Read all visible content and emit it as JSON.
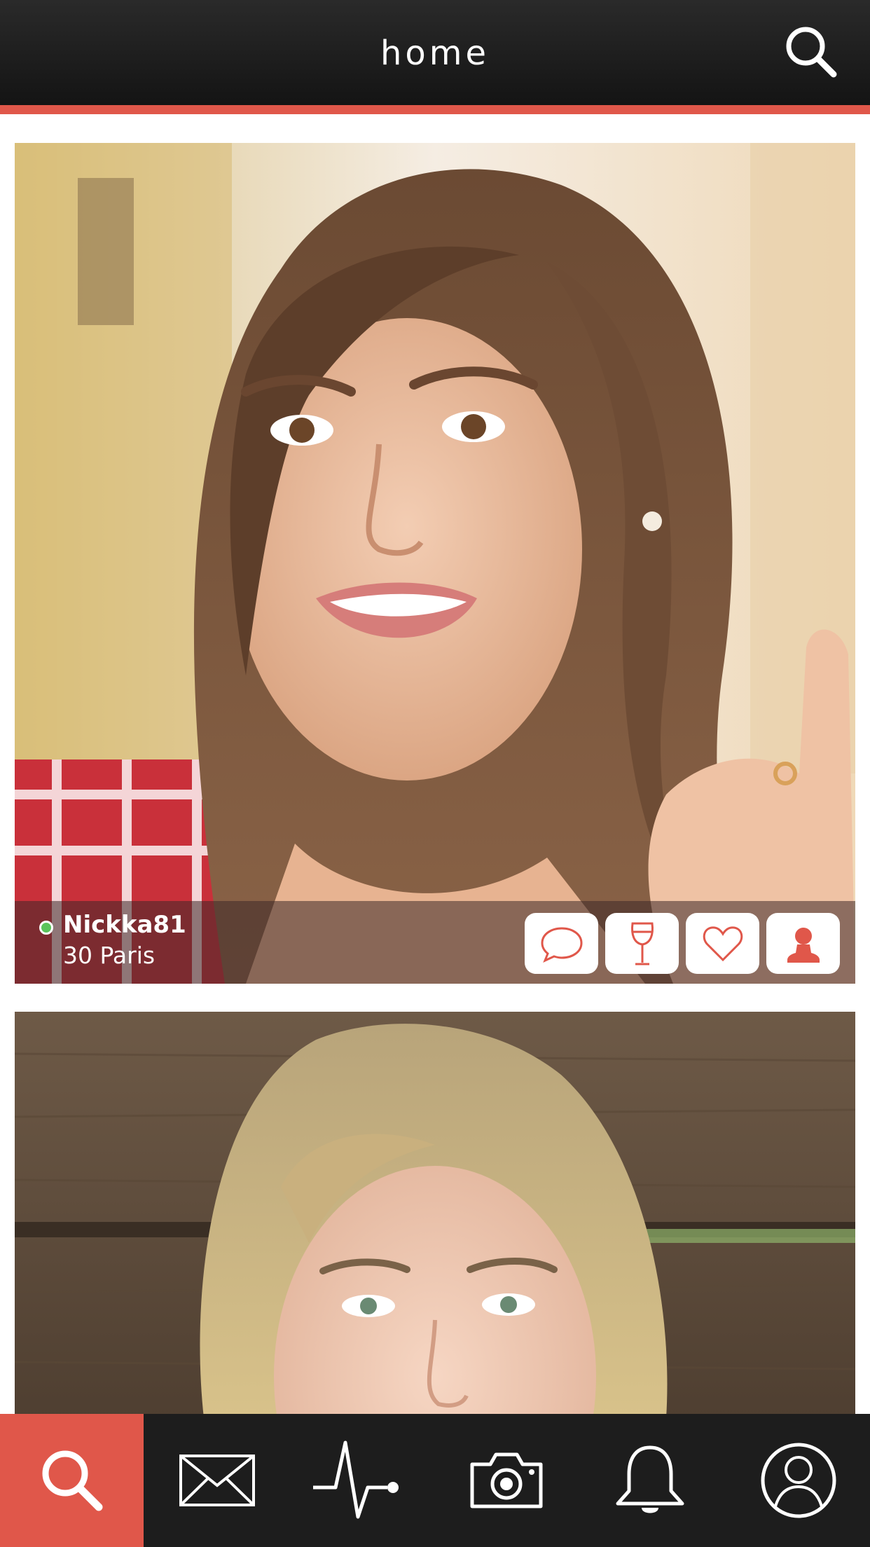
{
  "header": {
    "title": "home",
    "search_icon": "search-icon"
  },
  "colors": {
    "accent": "#e0574a",
    "header_bg": "#1a1a1a",
    "nav_bg": "#1d1d1d",
    "online": "#5ac35a"
  },
  "feed": [
    {
      "username": "Nickka81",
      "meta": "30 Paris",
      "online": true,
      "actions": [
        "chat-icon",
        "wine-glass-icon",
        "heart-icon",
        "user-icon"
      ]
    },
    {
      "username": "",
      "meta": "",
      "online": false,
      "actions": []
    }
  ],
  "bottom_nav": {
    "items": [
      {
        "icon": "search-icon",
        "active": true
      },
      {
        "icon": "envelope-icon",
        "active": false
      },
      {
        "icon": "activity-icon",
        "active": false
      },
      {
        "icon": "camera-icon",
        "active": false
      },
      {
        "icon": "bell-icon",
        "active": false
      },
      {
        "icon": "profile-icon",
        "active": false
      }
    ]
  }
}
